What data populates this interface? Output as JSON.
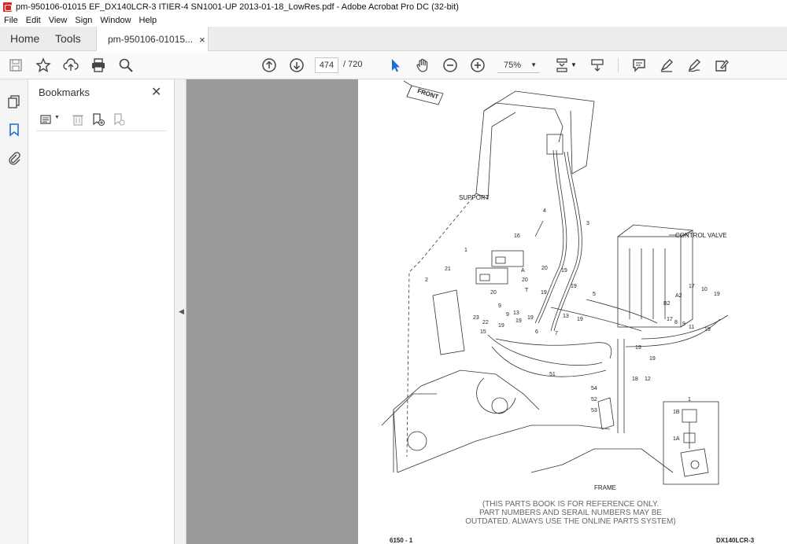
{
  "window": {
    "title": "pm-950106-01015 EF_DX140LCR-3 ITIER-4 SN1001-UP 2013-01-18_LowRes.pdf - Adobe Acrobat Pro DC (32-bit)",
    "app_icon": "acrobat-icon",
    "accent": "#d9251c"
  },
  "menu": [
    "File",
    "Edit",
    "View",
    "Sign",
    "Window",
    "Help"
  ],
  "tabs": {
    "home": "Home",
    "tools": "Tools",
    "document": "pm-950106-01015...",
    "close": "×"
  },
  "toolbar": {
    "icons": [
      "save-icon",
      "bookmark-star-icon",
      "upload-cloud-icon",
      "print-icon",
      "search-icon",
      "prev-page-icon",
      "next-page-icon",
      "select-arrow-icon",
      "hand-tool-icon",
      "zoom-out-icon",
      "zoom-in-icon",
      "fit-page-icon",
      "scroll-mode-icon",
      "comment-icon",
      "highlight-icon",
      "sign-icon",
      "fill-sign-icon"
    ],
    "current_page": "474",
    "total_pages": "/ 720",
    "zoom": "75%"
  },
  "bookmarks": {
    "title": "Bookmarks",
    "close": "✕"
  },
  "document": {
    "labels": {
      "front": "FRONT",
      "support": "SUPPORT",
      "control_valve": "CONTROL VALVE",
      "frame": "FRAME"
    },
    "part_numbers": [
      "16",
      "4",
      "3",
      "1",
      "21",
      "2",
      "20",
      "A",
      "20",
      "19",
      "T",
      "19",
      "20",
      "9",
      "13",
      "19",
      "19",
      "5",
      "17",
      "10",
      "19",
      "A2",
      "B2",
      "17",
      "8",
      "9",
      "11",
      "19",
      "13",
      "19",
      "23",
      "9",
      "19",
      "22",
      "19",
      "15",
      "6",
      "7",
      "19",
      "19",
      "51",
      "18",
      "12",
      "54",
      "52",
      "53",
      "1",
      "1B",
      "1A"
    ],
    "disclaimer_lines": [
      "(THIS PARTS BOOK IS FOR REFERENCE ONLY.",
      "PART NUMBERS AND SERAIL NUMBERS MAY BE",
      "OUTDATED. ALWAYS USE THE ONLINE PARTS SYSTEM)"
    ],
    "footer_left": "6150 - 1",
    "footer_right": "DX140LCR-3"
  }
}
